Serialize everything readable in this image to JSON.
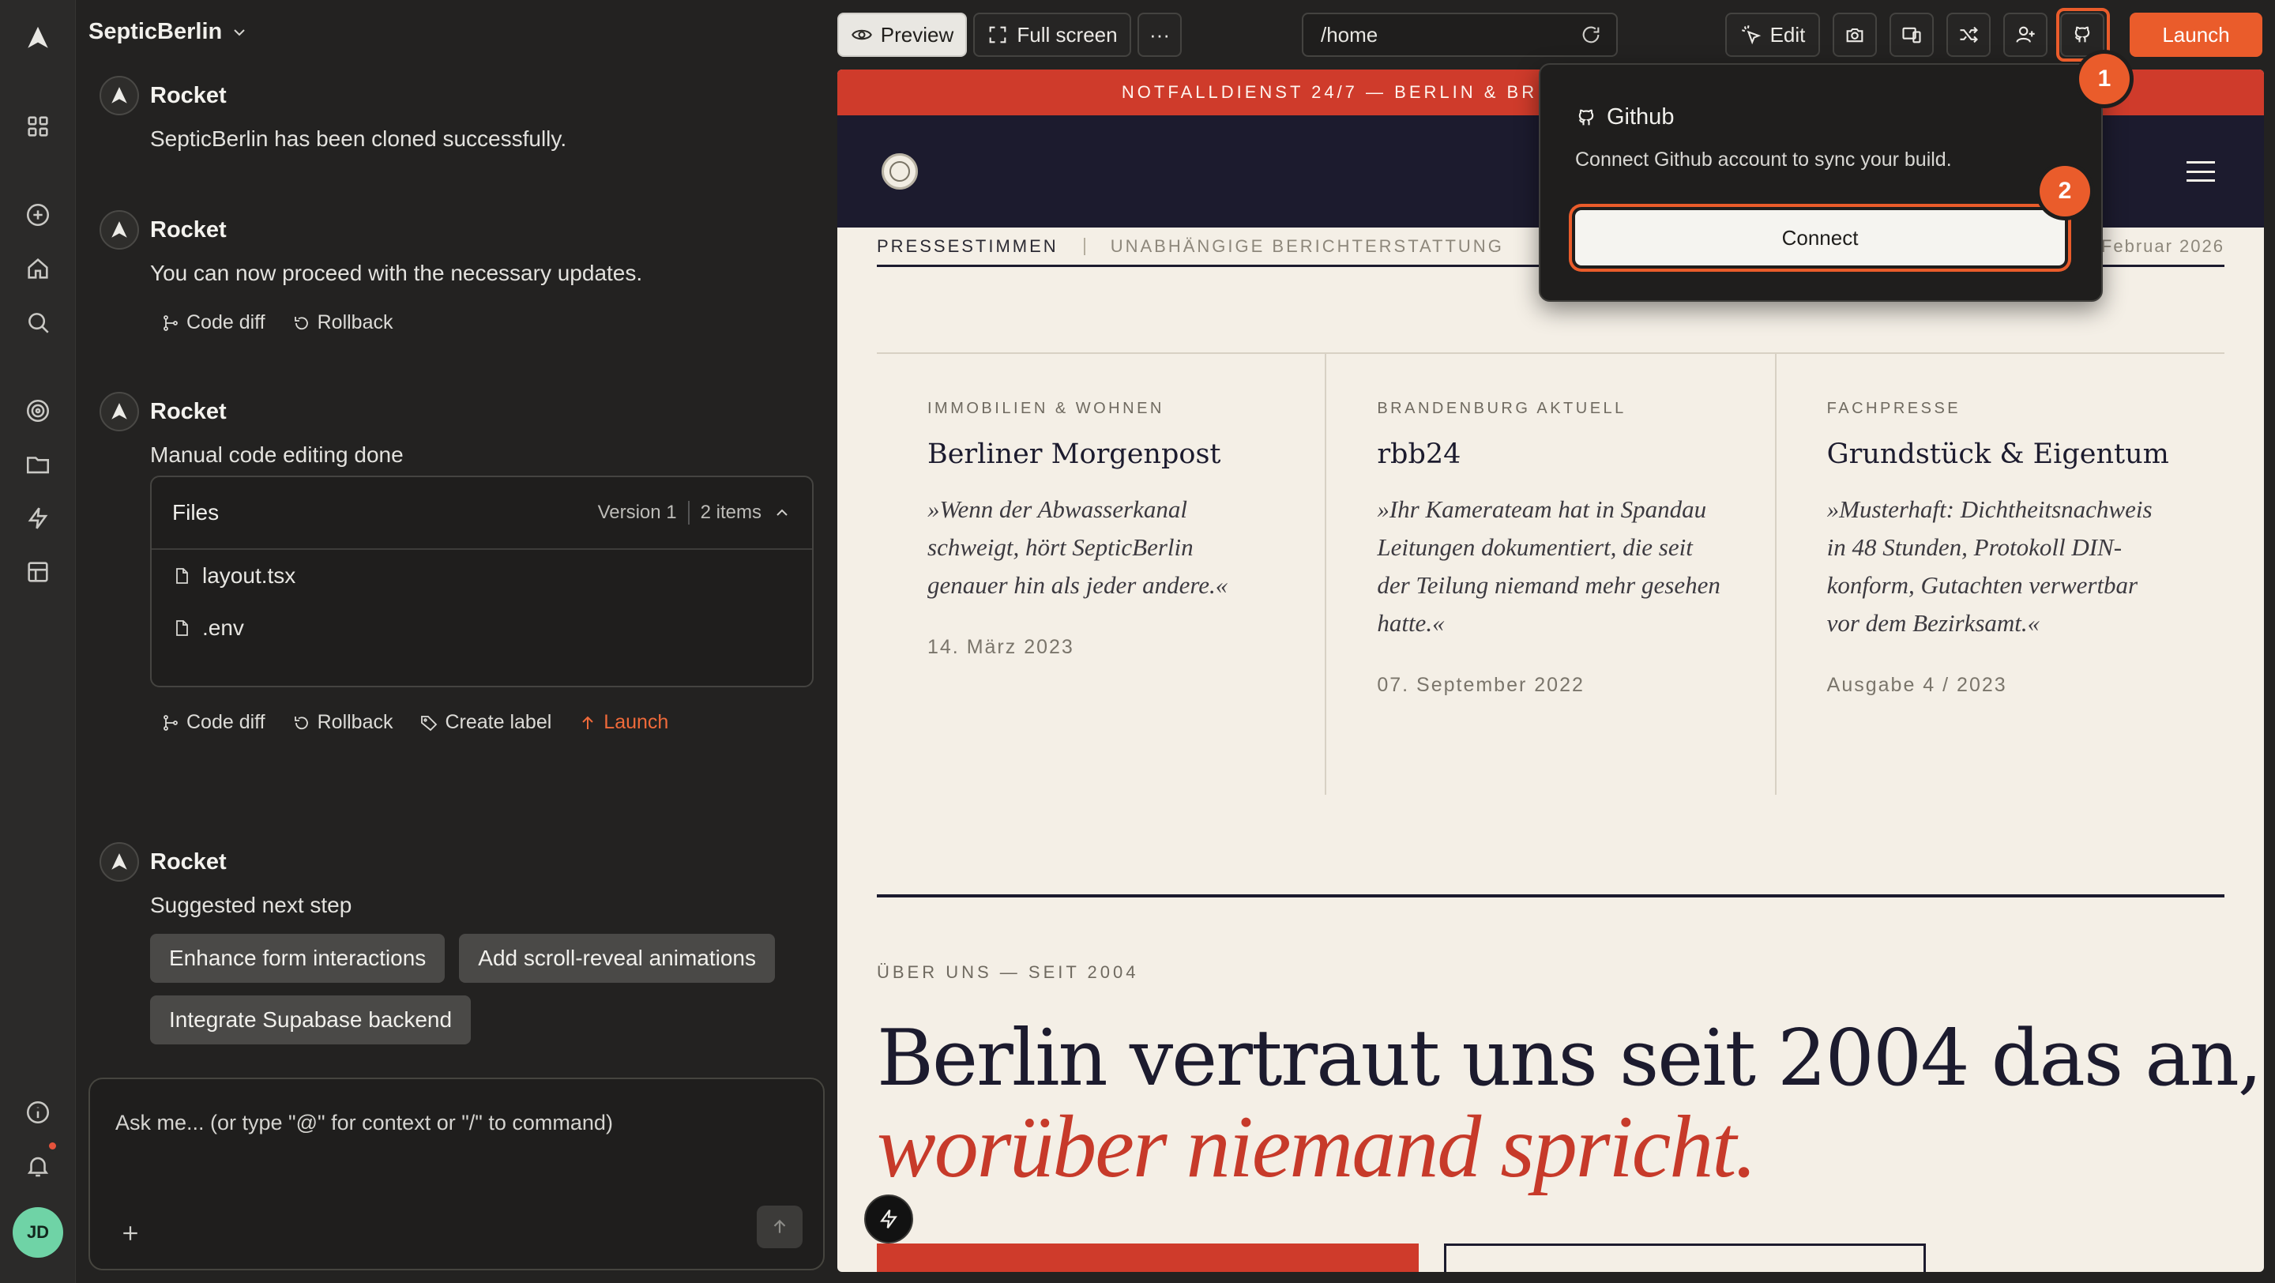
{
  "project": {
    "name": "SepticBerlin"
  },
  "messages": [
    {
      "author": "Rocket",
      "text": "SepticBerlin has been cloned successfully."
    },
    {
      "author": "Rocket",
      "text": "You can now proceed with the necessary updates."
    },
    {
      "author": "Rocket",
      "text": "Manual code editing done"
    },
    {
      "author": "Rocket",
      "text": "Suggested next step"
    }
  ],
  "actions1": {
    "code_diff": "Code diff",
    "rollback": "Rollback"
  },
  "actions2": {
    "code_diff": "Code diff",
    "rollback": "Rollback",
    "create_label": "Create label",
    "launch": "Launch"
  },
  "files": {
    "title": "Files",
    "version": "Version 1",
    "count": "2 items",
    "items": [
      "layout.tsx",
      ".env"
    ]
  },
  "suggestions": [
    "Enhance form interactions",
    "Add scroll-reveal animations",
    "Integrate Supabase backend"
  ],
  "composer": {
    "placeholder": "Ask me... (or type \"@\" for context or \"/\" to command)"
  },
  "user": {
    "initials": "JD"
  },
  "toolbar": {
    "preview": "Preview",
    "fullscreen": "Full screen",
    "more": "···",
    "url": "/home",
    "edit": "Edit",
    "launch": "Launch"
  },
  "popover": {
    "title": "Github",
    "description": "Connect Github account to sync your build.",
    "button": "Connect"
  },
  "badges": {
    "one": "1",
    "two": "2"
  },
  "site": {
    "banner": "NOTFALLDIENST 24/7 — BERLIN & BR",
    "press_label": "PRESSESTIMMEN",
    "press_sub": "UNABHÄNGIGE BERICHTERSTATTUNG",
    "press_date": "Februar 2026",
    "cards": [
      {
        "category": "IMMOBILIEN & WOHNEN",
        "name": "Berliner Morgenpost",
        "quote": "»Wenn der Abwasserkanal schweigt, hört SepticBerlin genauer hin als jeder andere.«",
        "date": "14. März 2023"
      },
      {
        "category": "BRANDENBURG AKTUELL",
        "name": "rbb24",
        "quote": "»Ihr Kamerateam hat in Spandau Leitungen dokumentiert, die seit der Teilung niemand mehr gesehen hatte.«",
        "date": "07. September 2022"
      },
      {
        "category": "FACHPRESSE",
        "name": "Grundstück & Eigentum",
        "quote": "»Musterhaft: Dichtheitsnachweis in 48 Stunden, Protokoll DIN-konform, Gutachten verwertbar vor dem Bezirksamt.«",
        "date": "Ausgabe 4 / 2023"
      }
    ],
    "about_kicker": "ÜBER UNS — SEIT 2004",
    "hero_line1": "Berlin vertraut uns seit 2004 das an,",
    "hero_line2": "worüber niemand spricht."
  },
  "colors": {
    "accent": "#ea5c2b",
    "site_red": "#cf3b2b",
    "site_navy": "#1c1b2e",
    "site_bg": "#f4efe6"
  }
}
